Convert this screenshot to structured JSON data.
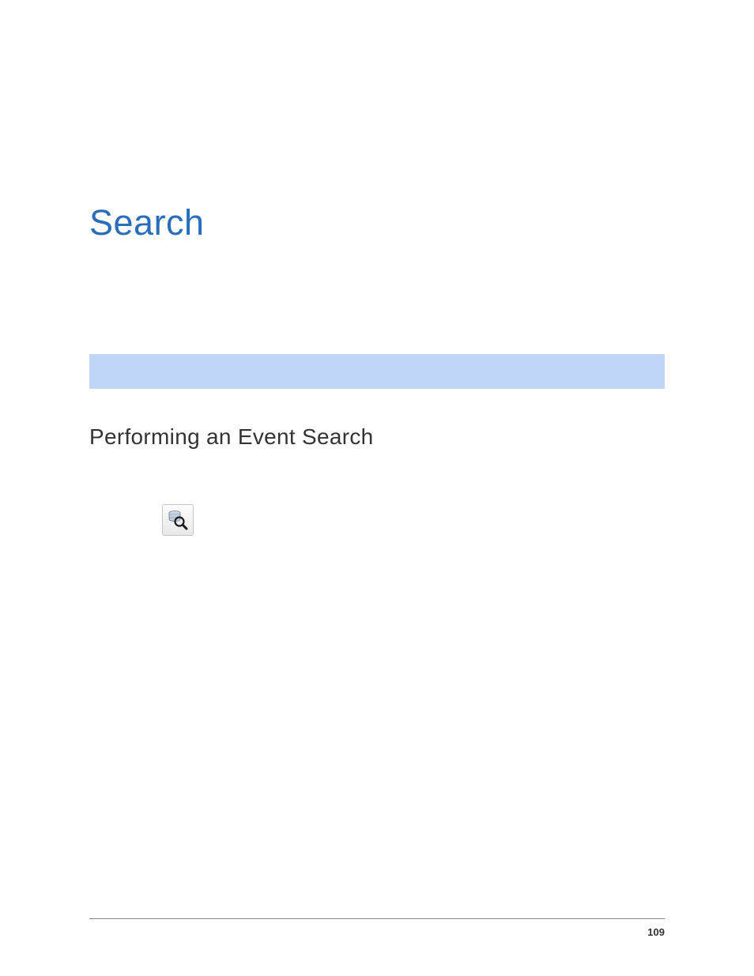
{
  "chapter": {
    "title": "Search"
  },
  "section": {
    "heading": "Performing an Event Search"
  },
  "footer": {
    "page_number": "109"
  },
  "colors": {
    "title": "#2a6ebb",
    "divider": "#bfd6f6"
  }
}
